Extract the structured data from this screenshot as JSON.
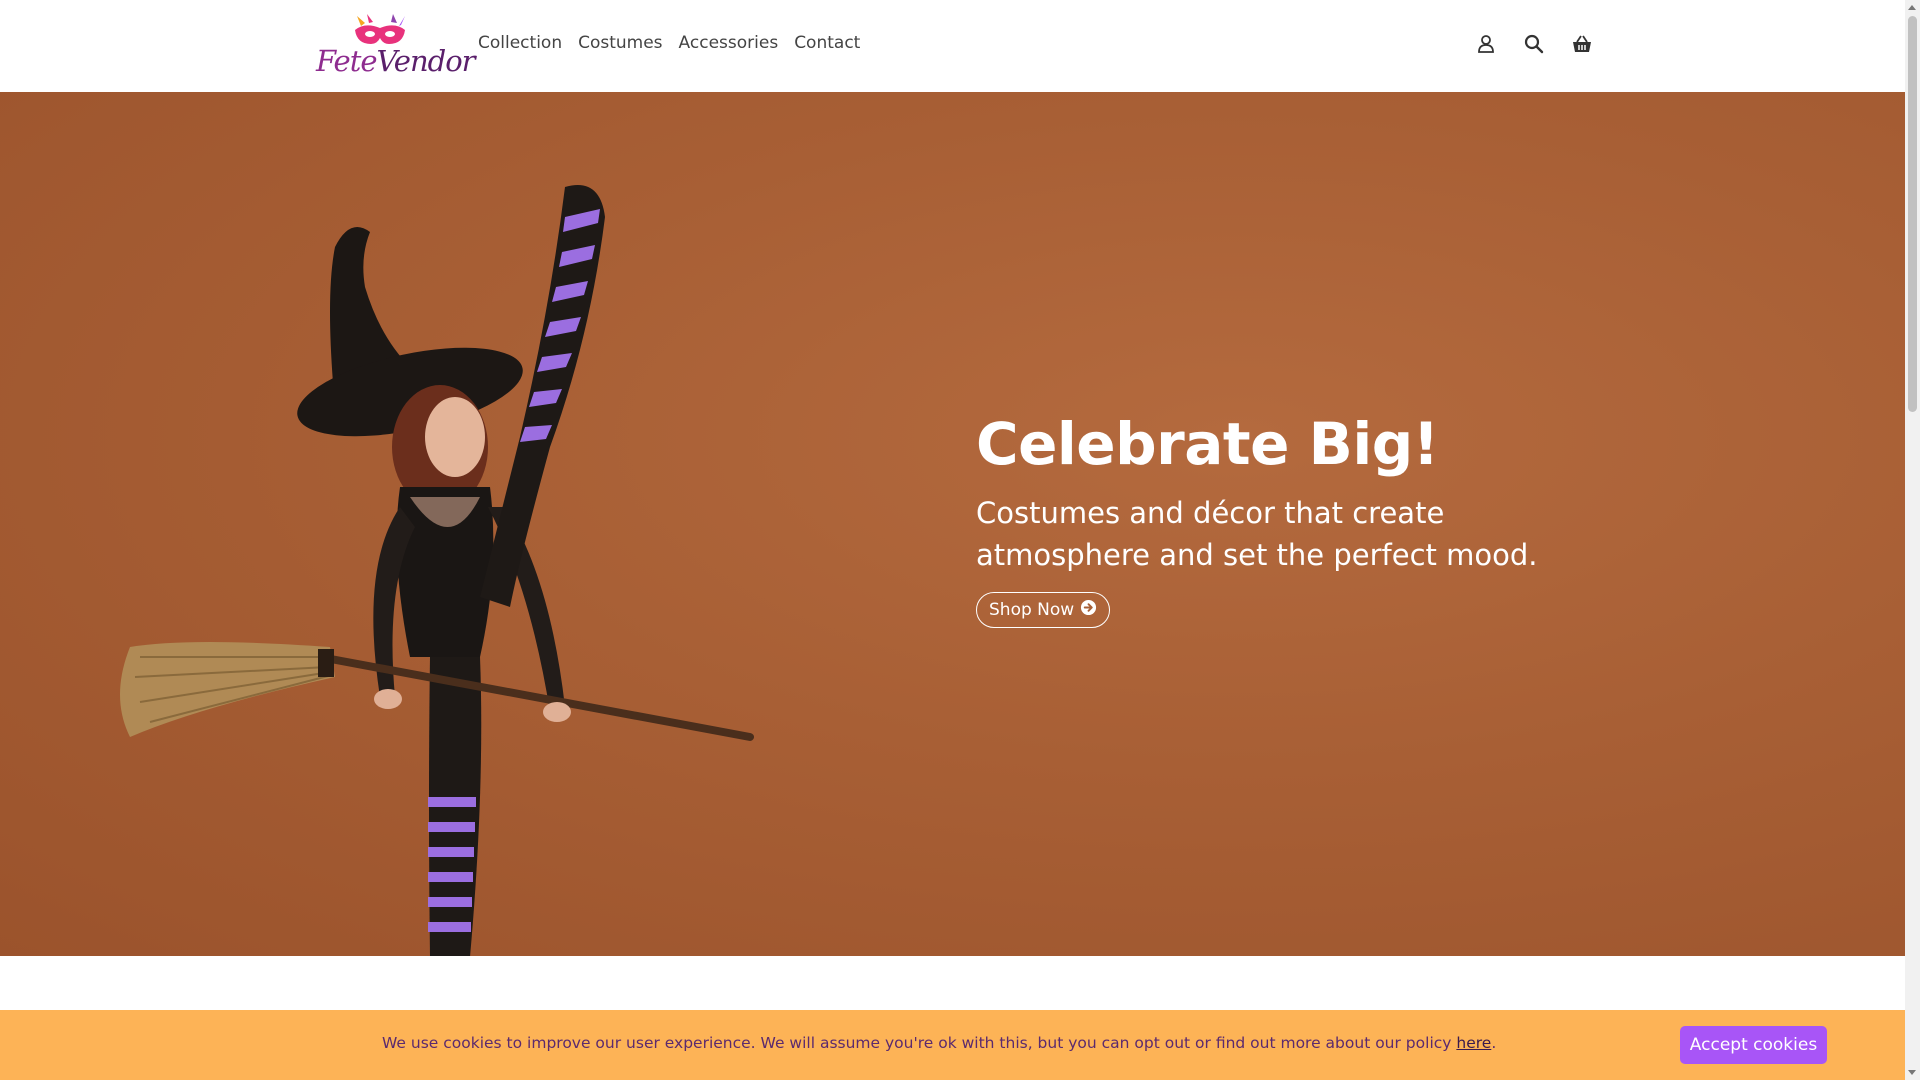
{
  "brand": {
    "name_part1": "Fete",
    "name_part2": "Vendor"
  },
  "nav": {
    "items": [
      {
        "label": "Collection"
      },
      {
        "label": "Costumes"
      },
      {
        "label": "Accessories"
      },
      {
        "label": "Contact"
      }
    ]
  },
  "header_icons": [
    "user-icon",
    "search-icon",
    "basket-icon"
  ],
  "hero": {
    "title": "Celebrate Big!",
    "subtitle": "Costumes and décor that create atmosphere and set the perfect mood.",
    "cta_label": "Shop Now"
  },
  "cookie": {
    "text": "We use cookies to improve our user experience. We will assume you're ok with this, but you can opt out or find out more about our policy ",
    "link_label": "here",
    "suffix": ".",
    "accept_label": "Accept cookies"
  },
  "colors": {
    "hero_bg": "#a85f35",
    "cookie_bg": "#fdb356",
    "accept_button": "#a855f7",
    "brand_purple": "#8e2c8f"
  }
}
